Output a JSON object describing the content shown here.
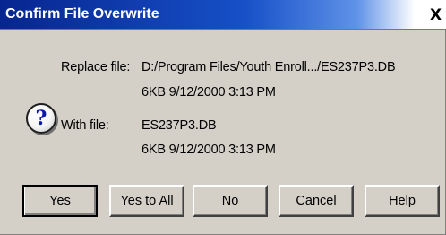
{
  "window": {
    "title": "Confirm File Overwrite",
    "close_glyph": "X"
  },
  "icon": {
    "name": "question-icon",
    "glyph": "?"
  },
  "replace": {
    "label": "Replace file:",
    "path": "D:/Program Files/Youth Enroll.../ES237P3.DB",
    "details": "6KB  9/12/2000  3:13 PM"
  },
  "with": {
    "label": "With file:",
    "filename": "ES237P3.DB",
    "details": "6KB  9/12/2000  3:13 PM"
  },
  "buttons": {
    "yes": "Yes",
    "yes_to_all": "Yes to All",
    "no": "No",
    "cancel": "Cancel",
    "help": "Help"
  },
  "colors": {
    "title_bar": "#1750c8",
    "dialog_face": "#d4d0c8",
    "icon_glyph": "#0a18a8"
  }
}
